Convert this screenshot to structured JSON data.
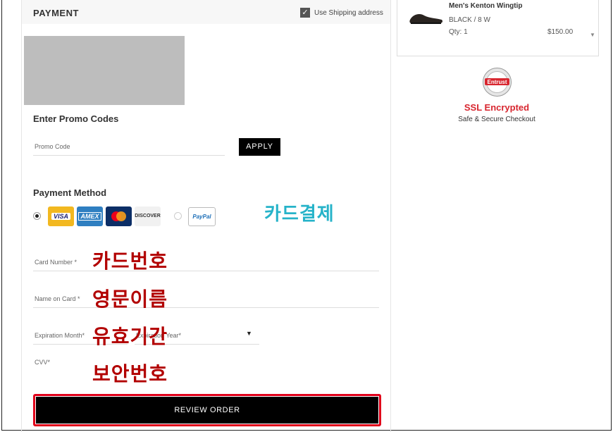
{
  "payment": {
    "title": "PAYMENT",
    "use_shipping_label": "Use Shipping address",
    "use_shipping_checked": true,
    "promo_title": "Enter Promo Codes",
    "promo_placeholder": "Promo Code",
    "apply_label": "APPLY",
    "method_title": "Payment Method",
    "cards": [
      "VISA",
      "AMEX",
      "",
      "DISCOVER"
    ],
    "paypal_label": "PayPal",
    "selected_method": "card",
    "fields": {
      "card_number": "Card Number *",
      "name_on_card": "Name on Card *",
      "exp_month": "Expiration Month*",
      "exp_year": "Expiration Year*",
      "cvv": "CVV*"
    },
    "review_label": "REVIEW ORDER"
  },
  "annotations": {
    "card_payment": "카드결제",
    "card_number": "카드번호",
    "english_name": "영문이름",
    "expiry": "유효기간",
    "security_code": "보안번호"
  },
  "order_item": {
    "name": "Men's Kenton Wingtip",
    "variant": "BLACK / 8 W",
    "qty": "Qty: 1",
    "price": "$150.00"
  },
  "security": {
    "seal_text": "Entrust",
    "title": "SSL Encrypted",
    "subtitle": "Safe & Secure Checkout"
  },
  "colors": {
    "annotation_red": "#b20000",
    "annotation_cyan": "#26b3c9",
    "highlight_red": "#e0001a",
    "ssl_red": "#d8262f"
  }
}
